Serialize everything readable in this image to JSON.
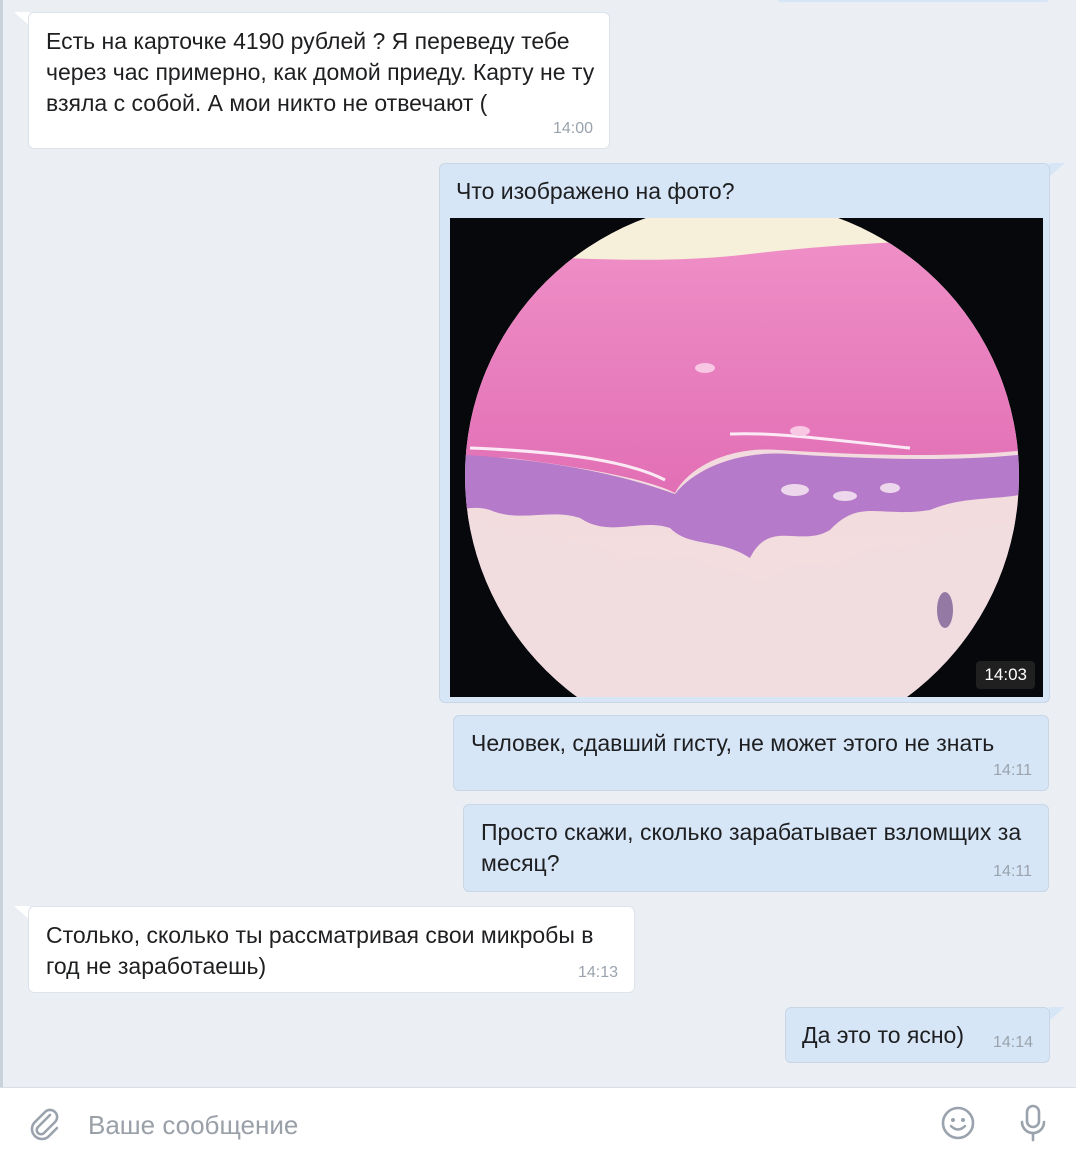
{
  "messages": [
    {
      "direction": "incoming",
      "text": "Есть на карточке 4190 рублей ? Я переведу тебе через час примерно, как домой приеду. Карту не ту взяла с собой. А мои никто не отвечают (",
      "time": "14:00"
    },
    {
      "direction": "outgoing",
      "text": "Что изображено на фото?",
      "time": "14:03",
      "attachment": "histology-slide-photo"
    },
    {
      "direction": "outgoing",
      "text": "Человек, сдавший гисту, не может этого не знать",
      "time": "14:11"
    },
    {
      "direction": "outgoing",
      "text": "Просто скажи, сколько зарабатывает взломщих за месяц?",
      "time": "14:11"
    },
    {
      "direction": "incoming",
      "text": "Столько, сколько ты рассматривая свои микробы в год не заработаешь)",
      "time": "14:13"
    },
    {
      "direction": "outgoing",
      "text": "Да это то ясно)",
      "time": "14:14"
    }
  ],
  "composer": {
    "placeholder": "Ваше сообщение",
    "attach_icon": "paperclip-icon",
    "emoji_icon": "smiley-icon",
    "voice_icon": "microphone-icon"
  },
  "colors": {
    "background": "#ebeff4",
    "incoming_bubble": "#ffffff",
    "outgoing_bubble": "#d7e6f7",
    "time_text": "#9aa3ad"
  }
}
